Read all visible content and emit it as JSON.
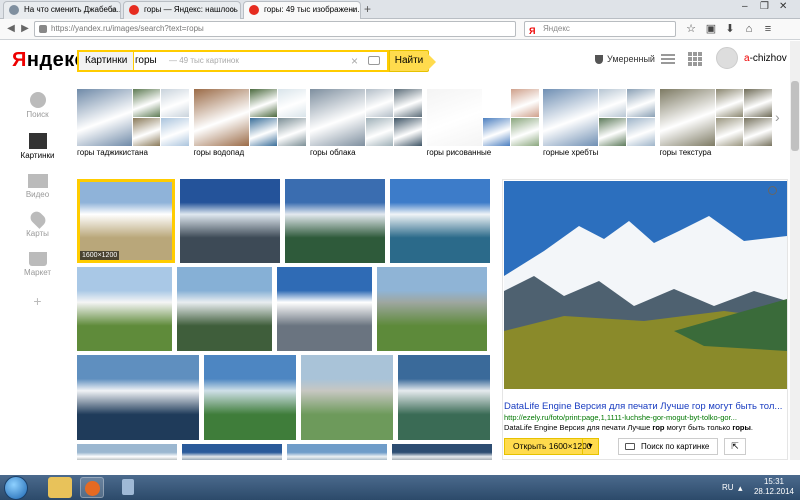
{
  "browser": {
    "tabs": [
      {
        "title": "На что сменить Джабеба...",
        "favicon_color": "#7f8f9f",
        "active": false
      },
      {
        "title": "горы — Яндекс: нашлось ...",
        "favicon_color": "#e62c20",
        "active": false
      },
      {
        "title": "горы: 49 тыс изображени...",
        "favicon_color": "#e62c20",
        "active": true
      }
    ],
    "new_tab": "+",
    "url": "https://yandex.ru/images/search?text=горы",
    "search_engine_glyph": "Я",
    "search_placeholder": "Яндекс",
    "toolbar_icons": [
      "star-icon",
      "clipboard-icon",
      "download-icon",
      "home-icon",
      "menu-icon"
    ]
  },
  "header": {
    "logo_first": "Я",
    "logo_rest": "ндекс",
    "search_type": "Картинки",
    "query": "горы",
    "result_count": "— 49 тыс картинок",
    "search_button": "Найти",
    "safety_label": "Умеренный",
    "username_first": "a",
    "username_rest": "-chizhov",
    "accent": "#ffcc00"
  },
  "sidebar": {
    "items": [
      {
        "label": "Поиск",
        "icon": "search-icon",
        "active": false
      },
      {
        "label": "Картинки",
        "icon": "image-icon",
        "active": true
      },
      {
        "label": "Видео",
        "icon": "video-icon",
        "active": false
      },
      {
        "label": "Карты",
        "icon": "map-pin-icon",
        "active": false
      },
      {
        "label": "Маркет",
        "icon": "cart-icon",
        "active": false
      },
      {
        "label": "",
        "icon": "plus-icon",
        "active": false
      }
    ]
  },
  "related": [
    {
      "label": "горы таджикистана",
      "colors": [
        "#6f8aa8",
        "#5e7b54",
        "#c9d3dc",
        "#8a7a5a",
        "#aac4dd"
      ]
    },
    {
      "label": "горы водопад",
      "colors": [
        "#9b6b47",
        "#4c6a3f",
        "#d9e4ea",
        "#3b6f9a",
        "#7c8f96"
      ]
    },
    {
      "label": "горы облака",
      "colors": [
        "#7e8f9f",
        "#b3bec8",
        "#5d6e7a",
        "#9fb0b8",
        "#3f5566"
      ]
    },
    {
      "label": "горы рисованные",
      "colors": [
        "#f4f4f4",
        "#ffffff",
        "#cfa08b",
        "#4c7fc0",
        "#8aa67d"
      ]
    },
    {
      "label": "горные хребты",
      "colors": [
        "#6f8fb3",
        "#b7c6d3",
        "#8aa0b5",
        "#5e7b5c",
        "#9eb4c9"
      ]
    },
    {
      "label": "горы текстура",
      "colors": [
        "#7d7a63",
        "#8b8770",
        "#6f6c58",
        "#9a9680",
        "#787460"
      ]
    }
  ],
  "results": {
    "selected_size": "1600×1200",
    "thumbs": [
      {
        "colors": [
          "#8fb3d9",
          "#ffffff",
          "#b9a77a"
        ]
      },
      {
        "colors": [
          "#24539a",
          "#dfe8f0",
          "#3d4a56"
        ]
      },
      {
        "colors": [
          "#3a6db0",
          "#e3e9ef",
          "#2e5a3a"
        ]
      },
      {
        "colors": [
          "#3d7cc9",
          "#f0f4f7",
          "#2b6a8a"
        ]
      },
      {
        "colors": [
          "#a9c8e6",
          "#f5f5f5",
          "#5f8b3a"
        ]
      },
      {
        "colors": [
          "#86b0d6",
          "#e9edf0",
          "#3f5e3b"
        ]
      },
      {
        "colors": [
          "#2f6bb5",
          "#ffffff",
          "#6a7480"
        ]
      },
      {
        "colors": [
          "#8fb4d6",
          "#9ea7a0",
          "#5d8a3a"
        ]
      },
      {
        "colors": [
          "#5f8fbf",
          "#f1f3f6",
          "#1f3b5a"
        ]
      },
      {
        "colors": [
          "#4d86c2",
          "#cfe0e8",
          "#3f7d3a"
        ]
      },
      {
        "colors": [
          "#a9c3d8",
          "#c7c7c2",
          "#6d9a5b"
        ]
      },
      {
        "colors": [
          "#3a6a9a",
          "#e5eaee",
          "#3a6b55"
        ]
      },
      {
        "colors": [
          "#9bb7d0",
          "#ffffff",
          "#5b6a70"
        ]
      },
      {
        "colors": [
          "#2a5a9a",
          "#e2e6ea",
          "#2d4d6a"
        ]
      },
      {
        "colors": [
          "#6f9cc9",
          "#edf1f4",
          "#4a6d8a"
        ]
      },
      {
        "colors": [
          "#2d4d72",
          "#e7ebee",
          "#4a5a66"
        ]
      }
    ]
  },
  "preview": {
    "title": "DataLife Engine Версия для печати Лучше гор могут быть тол...",
    "url": "http://ezely.ru/foto/print:page,1,1111-luchshe-gor-mogut-byt-tolko-gor...",
    "desc_before": "DataLife Engine Версия для печати Лучше ",
    "desc_bold1": "гор",
    "desc_mid": " могут быть только ",
    "desc_bold2": "горы",
    "desc_after": ".",
    "open_button": "Открыть 1600×1200",
    "search_by_image": "Поиск по картинке",
    "colors": {
      "sky": "#2c6fbe",
      "snow": "#f3f6f9",
      "rock": "#4e6170",
      "meadow": "#8a8a2a",
      "slope": "#3a6b3a"
    }
  },
  "taskbar": {
    "apps": [
      {
        "icon": "folder-icon",
        "color": "#e8c25a"
      },
      {
        "icon": "firefox-icon",
        "color": "#e56a23"
      },
      {
        "icon": "calculator-icon",
        "color": "#9fb9d6"
      }
    ],
    "lang": "RU",
    "time": "15:31",
    "date": "28.12.2014"
  }
}
